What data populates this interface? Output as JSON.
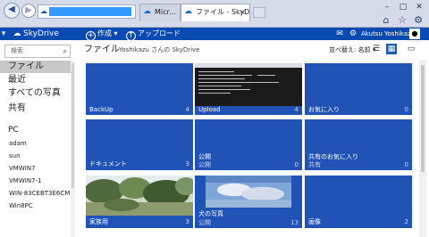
{
  "browser": {
    "tabs": [
      {
        "label": "Micr..."
      },
      {
        "label": "ファイル - SkyDrive",
        "close": "×"
      }
    ],
    "window_controls": {
      "minimize": "–",
      "maximize": "□",
      "close": "✕"
    },
    "toolbar_icons": [
      "home-icon",
      "star-icon",
      "gear-icon"
    ]
  },
  "header": {
    "logo": "SkyDrive",
    "actions": [
      {
        "icon": "plus-icon",
        "label": "作成"
      },
      {
        "icon": "upload-icon",
        "label": "アップロード"
      }
    ],
    "user_name": "Akutsu Yoshikazu"
  },
  "sidebar": {
    "search_placeholder": "検索",
    "nav": [
      {
        "label": "ファイル",
        "active": true
      },
      {
        "label": "最近"
      },
      {
        "label": "すべての写真"
      },
      {
        "label": "共有"
      }
    ],
    "pc_heading": "PC",
    "pcs": [
      "adam",
      "sun",
      "VMWIN7",
      "VMWIN7-1",
      "WIN-83CEBT3E6CM",
      "Win8PC"
    ]
  },
  "main": {
    "title": "ファイル",
    "subtitle": "Yoshikazu さんの SkyDrive",
    "sort_label": "並べ替え: 名前 ▾",
    "tiles": [
      {
        "name": "BackUp",
        "sub": "",
        "count": "4",
        "thumb": "none"
      },
      {
        "name": "Upload",
        "sub": "",
        "count": "4",
        "thumb": "terminal"
      },
      {
        "name": "お気に入り",
        "sub": "",
        "count": "0",
        "thumb": "none"
      },
      {
        "name": "ドキュメント",
        "sub": "",
        "count": "3",
        "thumb": "none"
      },
      {
        "name": "公開",
        "sub": "公開",
        "count": "0",
        "thumb": "none"
      },
      {
        "name": "共有のお気に入り",
        "sub": "共有",
        "count": "0",
        "thumb": "none"
      },
      {
        "name": "家族用",
        "sub": "",
        "count": "3",
        "thumb": "photo-trees"
      },
      {
        "name": "犬の写真",
        "sub": "公開",
        "count": "13",
        "thumb": "photo-sky"
      },
      {
        "name": "画像",
        "sub": "",
        "count": "2",
        "thumb": "none"
      }
    ]
  },
  "colors": {
    "header_bg": "#094ab2",
    "tile_bg": "#2153b6",
    "sidebar_active": "#c8c8c8"
  }
}
